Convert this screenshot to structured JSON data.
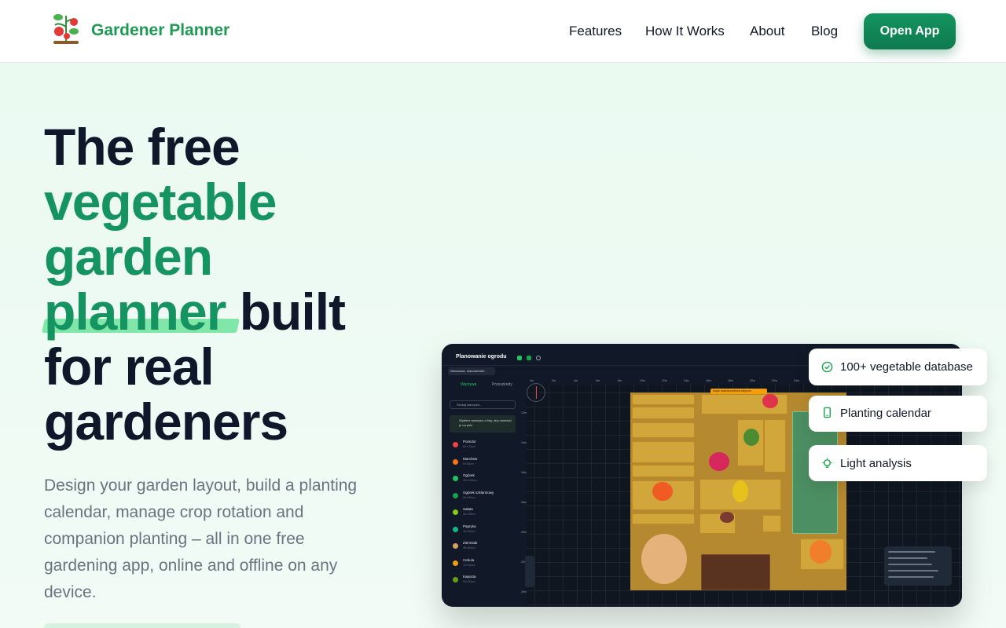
{
  "brand": {
    "name": "Gardener Planner",
    "logo_icon": "tomato-plant-icon",
    "color": "#1f9a54"
  },
  "nav": {
    "items": [
      {
        "label": "Features"
      },
      {
        "label": "How It Works"
      },
      {
        "label": "About"
      },
      {
        "label": "Blog"
      }
    ],
    "cta": "Open App"
  },
  "hero": {
    "title": {
      "line1": "The free",
      "line2": "vegetable",
      "line3": "garden",
      "line4_highlight": "planner",
      "line4_rest": " built",
      "line5": "for real",
      "line6": "gardeners"
    },
    "description": "Design your garden layout, build a planting calendar, manage crop rotation and companion planting – all in one free gardening app, online and offline on any device."
  },
  "app_preview": {
    "title": "Planowanie ogrodu",
    "location": "Warszawa, mazowieckie",
    "tabs": [
      "Warzywa",
      "Przeszkody"
    ],
    "search_placeholder": "Szukaj warzywa...",
    "hint": "Wybierz warzywo z listy, aby umieścić je na polu",
    "notice": "Mapa nasłonecznienia aktywna",
    "ruler_x": [
      "0m",
      "2m",
      "4m",
      "6m",
      "8m",
      "10m",
      "12m",
      "14m",
      "16m",
      "18m",
      "20m",
      "22m",
      "24m",
      "26m"
    ],
    "ruler_y": [
      "12m",
      "14m",
      "16m",
      "18m",
      "20m",
      "22m",
      "24m"
    ],
    "vegetables": [
      {
        "name": "Pomidor",
        "size": "60×70cm",
        "color": "#ef4444"
      },
      {
        "name": "Marchew",
        "size": "5×30cm",
        "color": "#f97316"
      },
      {
        "name": "Ogórek",
        "size": "40×100cm",
        "color": "#22c55e"
      },
      {
        "name": "Ogórek szklarniowy",
        "size": "50×90cm",
        "color": "#16a34a"
      },
      {
        "name": "Sałata",
        "size": "25×25cm",
        "color": "#84cc16"
      },
      {
        "name": "Papryka",
        "size": "40×50cm",
        "color": "#10b981"
      },
      {
        "name": "Ziemniak",
        "size": "30×60cm",
        "color": "#d6a15c"
      },
      {
        "name": "Cebula",
        "size": "10×25cm",
        "color": "#f59e0b"
      },
      {
        "name": "Kapusta",
        "size": "50×50cm",
        "color": "#65a30d"
      }
    ]
  },
  "features": [
    {
      "label": "100+ vegetable database",
      "icon": "check-circle-icon"
    },
    {
      "label": "Planting calendar",
      "icon": "mobile-icon"
    },
    {
      "label": "Light analysis",
      "icon": "lightbulb-icon"
    }
  ]
}
